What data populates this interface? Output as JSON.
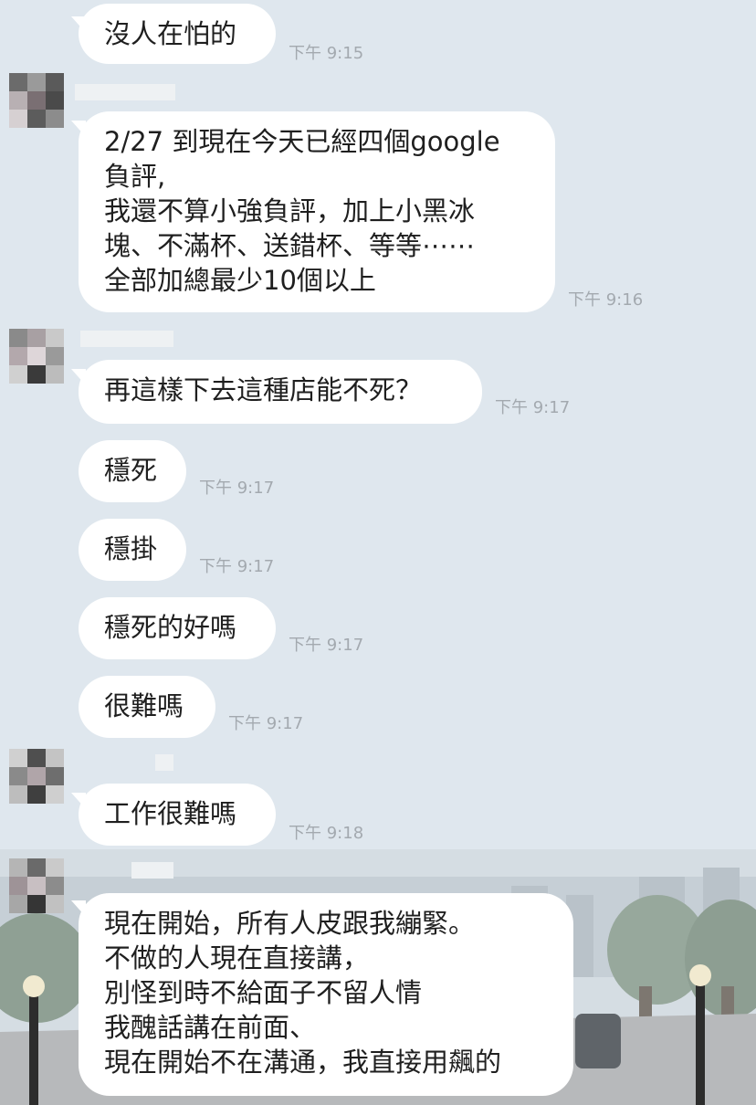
{
  "messages": [
    {
      "text": "沒人在怕的",
      "time": "下午 9:15"
    },
    {
      "text": "2/27 到現在今天已經四個google\n負評,\n我還不算小強負評，加上小黑冰\n塊、不滿杯、送錯杯、等等⋯⋯\n全部加總最少10個以上",
      "time": "下午 9:16"
    },
    {
      "text": "再這樣下去這種店能不死？",
      "time": "下午 9:17"
    },
    {
      "text": "穩死",
      "time": "下午 9:17"
    },
    {
      "text": "穩掛",
      "time": "下午 9:17"
    },
    {
      "text": "穩死的好嗎",
      "time": "下午 9:17"
    },
    {
      "text": "很難嗎",
      "time": "下午 9:17"
    },
    {
      "text": "工作很難嗎",
      "time": "下午 9:18"
    },
    {
      "text": "現在開始，所有人皮跟我繃緊。\n不做的人現在直接講，\n別怪到時不給面子不留人情\n我醜話講在前面、\n現在開始不在溝通，我直接用飆的",
      "time": ""
    }
  ],
  "colors": {
    "background": "#dfe7ee",
    "bubble": "#ffffff",
    "text": "#1f1f1f",
    "timestamp": "#a3a9af"
  }
}
